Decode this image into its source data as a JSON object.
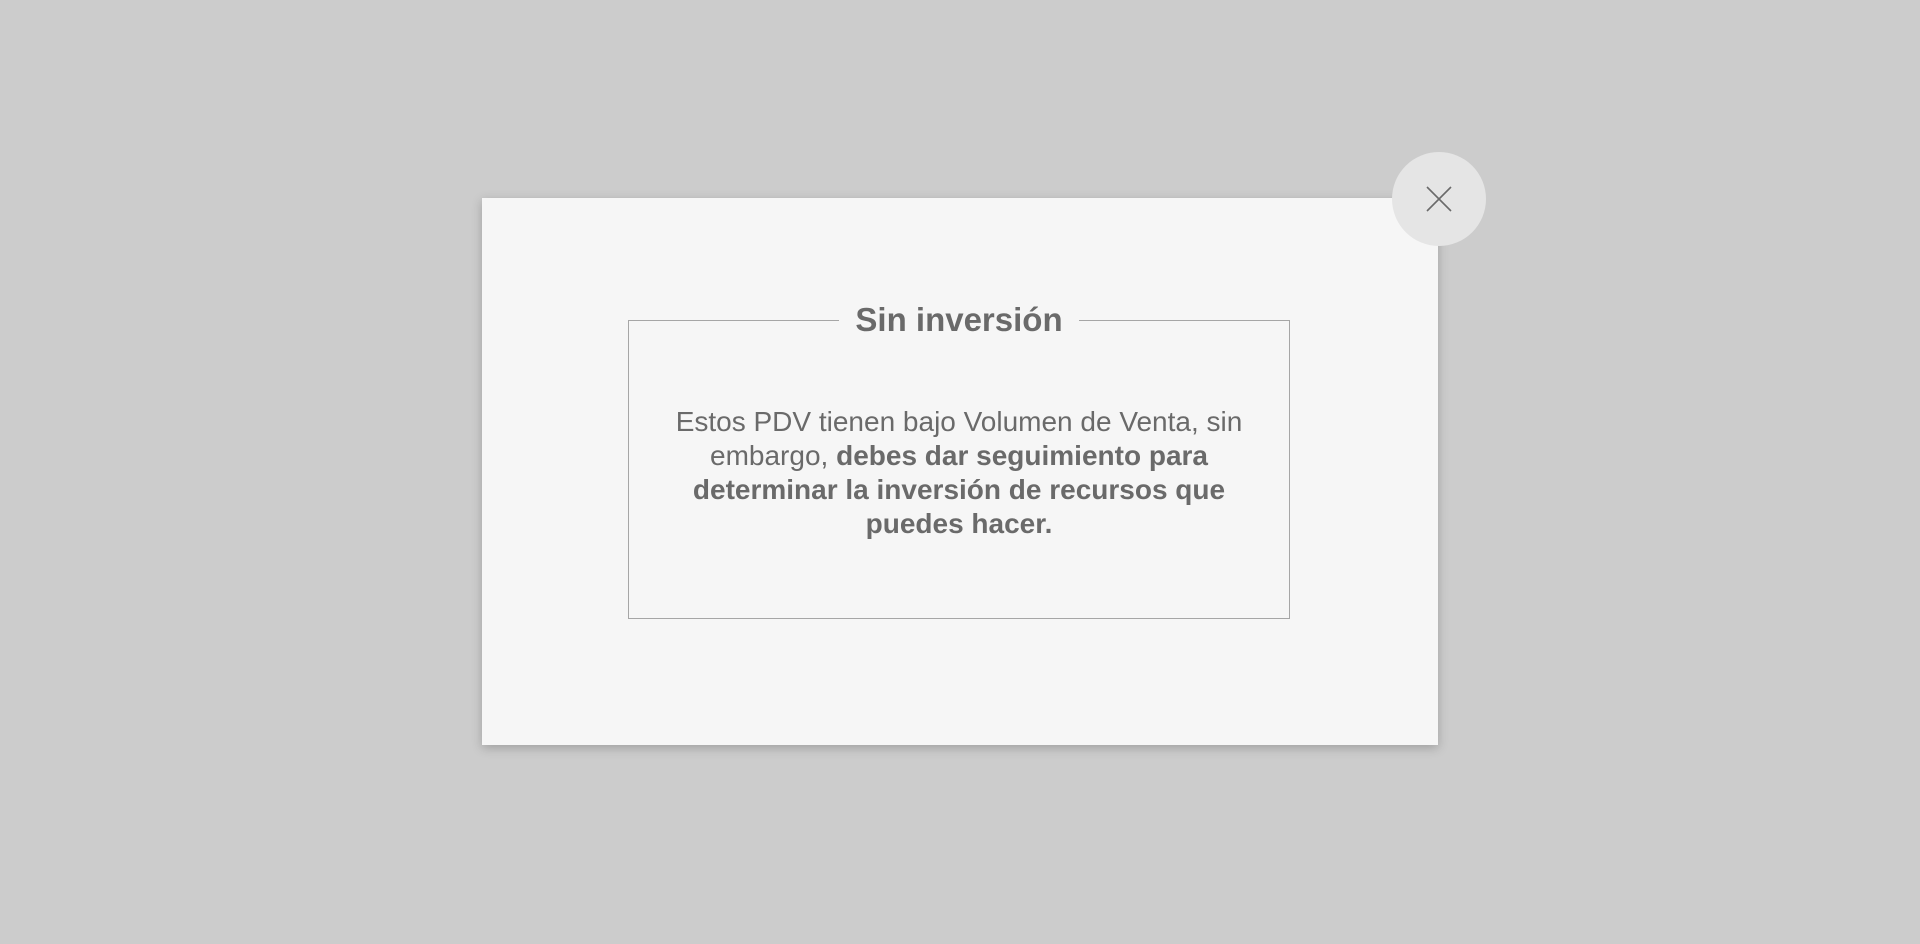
{
  "modal": {
    "title": "Sin inversión",
    "message_plain": "Estos PDV tienen bajo Volumen de Venta, sin embargo, ",
    "message_bold": "debes dar seguimiento para determinar la inversión de recursos que puedes hacer.",
    "close_icon": "close-icon"
  },
  "colors": {
    "backdrop": "#cccccc",
    "modal_bg": "#f6f6f6",
    "text": "#6a6a6a",
    "border": "#a6a6a6",
    "close_bg": "#e5e5e5"
  }
}
